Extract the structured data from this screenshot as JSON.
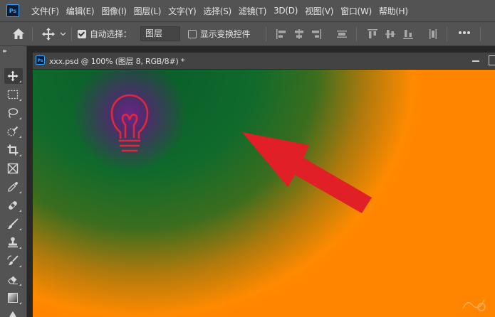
{
  "app": {
    "logo_text": "Ps",
    "menu": [
      "文件(F)",
      "编辑(E)",
      "图像(I)",
      "图层(L)",
      "文字(Y)",
      "选择(S)",
      "滤镜(T)",
      "3D(D)",
      "视图(V)",
      "窗口(W)",
      "帮助(H)"
    ]
  },
  "options": {
    "auto_select_label": "自动选择：",
    "auto_select_checked": true,
    "auto_select_value": "图层",
    "show_transform_label": "显示变换控件",
    "show_transform_checked": false
  },
  "toolbar": {
    "collapse_glyph": "▸▸",
    "tools": [
      "move-tool-icon",
      "marquee-tool-icon",
      "lasso-tool-icon",
      "quick-select-tool-icon",
      "crop-tool-icon",
      "frame-tool-icon",
      "eyedropper-tool-icon",
      "healing-brush-tool-icon",
      "brush-tool-icon",
      "clone-stamp-tool-icon",
      "history-brush-tool-icon",
      "eraser-tool-icon",
      "gradient-tool-icon",
      "blur-tool-icon"
    ]
  },
  "document": {
    "icon_text": "Ps",
    "tab_title": "xxx.psd @ 100% (图层 8, RGB/8#) *"
  },
  "colors": {
    "accent": "#31a8ff",
    "bulb": "#e0283c",
    "arrow": "#e01f26",
    "orange": "#ff8500",
    "green": "#0a5c2a",
    "purple": "#6a2488"
  }
}
